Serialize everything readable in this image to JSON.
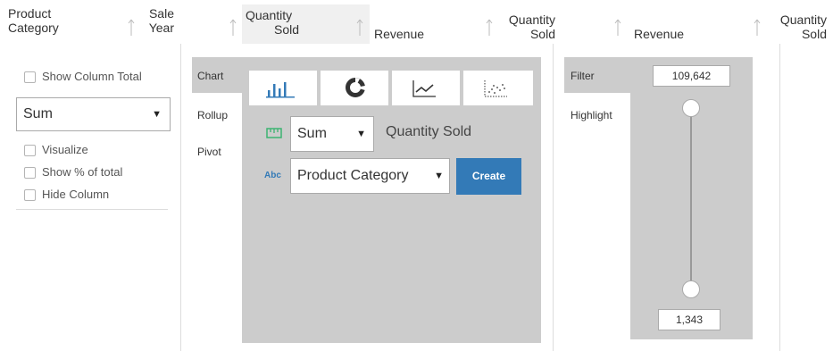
{
  "header": {
    "col1": [
      "Product",
      "Category"
    ],
    "col2": [
      "Sale",
      "Year"
    ],
    "col3": [
      "Quantity",
      "Sold"
    ],
    "col4": "Revenue",
    "col5": [
      "Quantity",
      "Sold"
    ],
    "col6": "Revenue",
    "col7": [
      "Quantity",
      "Sold"
    ]
  },
  "left_panel": {
    "show_column_total": "Show Column Total",
    "aggregate_value": "Sum",
    "visualize": "Visualize",
    "show_percent": "Show % of total",
    "hide_column": "Hide Column"
  },
  "chart_panel": {
    "tabs": [
      "Chart",
      "Rollup",
      "Pivot"
    ],
    "chart_types": [
      "bar-chart-icon",
      "pie-chart-icon",
      "line-chart-icon",
      "scatter-chart-icon"
    ],
    "measure_icon": "ruler-icon",
    "measure_agg": "Sum",
    "measure_field": "Quantity Sold",
    "dimension_icon": "abc-icon",
    "dimension_value": "Product Category",
    "create_label": "Create",
    "accent_color": "#337ab7"
  },
  "filter_panel": {
    "tabs": [
      "Filter",
      "Highlight"
    ],
    "max_value": "109,642",
    "min_value": "1,343"
  }
}
